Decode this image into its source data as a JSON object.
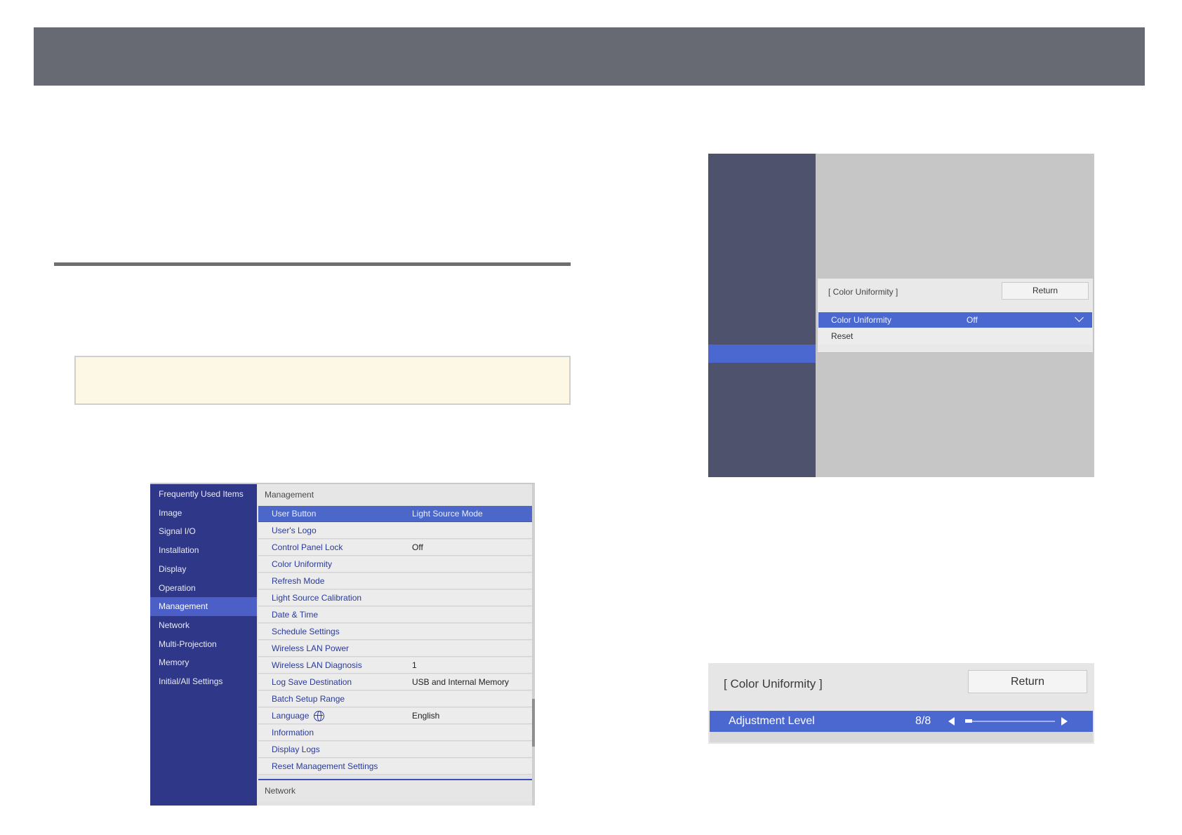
{
  "main_menu": {
    "sidebar": [
      {
        "label": "Frequently Used Items"
      },
      {
        "label": "Image"
      },
      {
        "label": "Signal I/O"
      },
      {
        "label": "Installation"
      },
      {
        "label": "Display"
      },
      {
        "label": "Operation"
      },
      {
        "label": "Management",
        "active": true
      },
      {
        "label": "Network"
      },
      {
        "label": "Multi-Projection"
      },
      {
        "label": "Memory"
      },
      {
        "label": "Initial/All Settings"
      }
    ],
    "section_title": "Management",
    "rows": [
      {
        "label": "User Button",
        "value": "Light Source Mode",
        "selected": true
      },
      {
        "label": "User's Logo",
        "value": ""
      },
      {
        "label": "Control Panel Lock",
        "value": "Off"
      },
      {
        "label": "Color Uniformity",
        "value": ""
      },
      {
        "label": "Refresh Mode",
        "value": ""
      },
      {
        "label": "Light Source Calibration",
        "value": ""
      },
      {
        "label": "Date & Time",
        "value": ""
      },
      {
        "label": "Schedule Settings",
        "value": ""
      },
      {
        "label": "Wireless LAN Power",
        "value": ""
      },
      {
        "label": "Wireless LAN Diagnosis",
        "value": "1"
      },
      {
        "label": "Log Save Destination",
        "value": "USB and Internal Memory"
      },
      {
        "label": "Batch Setup Range",
        "value": ""
      },
      {
        "label": "Language",
        "value": "English",
        "icon": "globe-icon"
      },
      {
        "label": "Information",
        "value": ""
      },
      {
        "label": "Display Logs",
        "value": ""
      },
      {
        "label": "Reset Management Settings",
        "value": ""
      }
    ],
    "next_section_title": "Network"
  },
  "color_uniformity_screen": {
    "title": "[ Color Uniformity ]",
    "return_label": "Return",
    "setting_label": "Color Uniformity",
    "setting_value": "Off",
    "reset_label": "Reset"
  },
  "adjustment_screen": {
    "title": "[ Color Uniformity ]",
    "return_label": "Return",
    "row_label": "Adjustment Level",
    "row_value": "8/8",
    "slider_fraction": 0.08
  },
  "colors": {
    "menu_sidebar": "#2f3888",
    "selection_blue": "#4a68cf",
    "topbar": "#676a72",
    "note_background": "#fdf8e6"
  }
}
